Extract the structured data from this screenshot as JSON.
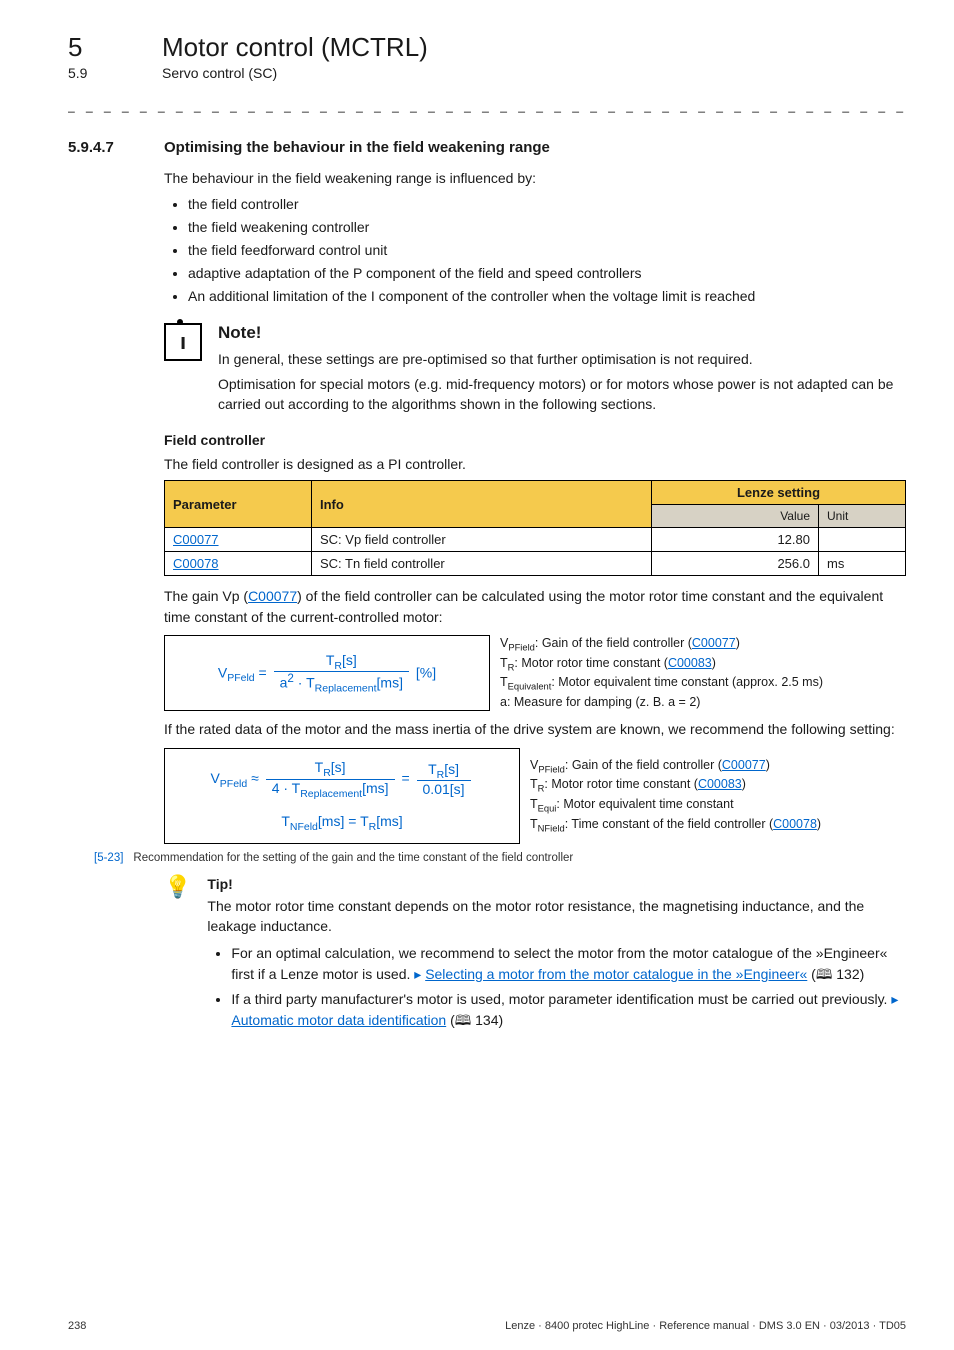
{
  "breadcrumb": {
    "chapter_num": "5",
    "chapter_title": "Motor control (MCTRL)",
    "section_num": "5.9",
    "section_title": "Servo control (SC)"
  },
  "dashes": "_ _ _ _ _ _ _ _ _ _ _ _ _ _ _ _ _ _ _ _ _ _ _ _ _ _ _ _ _ _ _ _ _ _ _ _ _ _ _ _ _ _ _ _ _ _ _ _ _ _ _ _ _ _ _ _ _ _ _ _ _ _ _ _",
  "heading": {
    "num": "5.9.4.7",
    "title": "Optimising the behaviour in the field weakening range"
  },
  "intro": "The behaviour in the field weakening range is influenced by:",
  "bullets": [
    "the field controller",
    "the field weakening controller",
    "the field feedforward control unit",
    "adaptive adaptation of the P component of the field and speed controllers",
    "An additional limitation of the I component of the controller when the voltage limit is reached"
  ],
  "note": {
    "title": "Note!",
    "p1": "In general, these settings are pre-optimised so that further optimisation is not required.",
    "p2": "Optimisation for special motors (e.g. mid-frequency motors) or for motors whose power is not adapted can be carried out according to the algorithms shown in the following sections."
  },
  "field_controller": {
    "heading": "Field controller",
    "text": "The field controller is designed as a PI controller."
  },
  "table": {
    "headers": {
      "param": "Parameter",
      "info": "Info",
      "lenze": "Lenze setting",
      "value": "Value",
      "unit": "Unit"
    },
    "rows": [
      {
        "param": "C00077",
        "info": "SC: Vp field controller",
        "value": "12.80",
        "unit": ""
      },
      {
        "param": "C00078",
        "info": "SC: Tn field controller",
        "value": "256.0",
        "unit": "ms"
      }
    ]
  },
  "gain_text_a": "The gain Vp (",
  "gain_link": "C00077",
  "gain_text_b": ") of the field controller can be calculated using the motor rotor time constant and the equivalent time constant of the current-controlled motor:",
  "formula1": {
    "lhs": "V",
    "lhs_sub": "PFeld",
    "num": "T",
    "num_sub": "R",
    "num_unit": "[s]",
    "den_a": "a",
    "den_sup": "2",
    "den_mid": " · T",
    "den_sub": "Replacement",
    "den_unit": "[ms]",
    "tail": " [%]"
  },
  "formula1_desc": {
    "l1a": "V",
    "l1sub": "PField",
    "l1b": ": Gain of the field controller (",
    "l1link": "C00077",
    "l1c": ")",
    "l2a": "T",
    "l2sub": "R",
    "l2b": ": Motor rotor time constant (",
    "l2link": "C00083",
    "l2c": ")",
    "l3a": "T",
    "l3sub": "Equivalent",
    "l3b": ": Motor equivalent time constant (approx. 2.5 ms)",
    "l4": "a: Measure for damping (z. B. a = 2)"
  },
  "mid_text": "If the rated data of the motor and the mass inertia of the drive system are known, we recommend the following setting:",
  "formula2": {
    "lhs": "V",
    "lhs_sub": "PFeld",
    "approx": " ≈ ",
    "f1_num": "T",
    "f1_num_sub": "R",
    "f1_num_unit": "[s]",
    "f1_den_a": "4 · T",
    "f1_den_sub": "Replacement",
    "f1_den_unit": "[ms]",
    "eq": " = ",
    "f2_num": "T",
    "f2_num_sub": "R",
    "f2_num_unit": "[s]",
    "f2_den": "0.01[s]",
    "line2_a": "T",
    "line2_a_sub": "NFeld",
    "line2_a_unit": "[ms]",
    "line2_eq": " = ",
    "line2_b": "T",
    "line2_b_sub": "R",
    "line2_b_unit": "[ms]"
  },
  "formula2_desc": {
    "l1a": "V",
    "l1sub": "PField",
    "l1b": ": Gain of the field controller (",
    "l1link": "C00077",
    "l1c": ")",
    "l2a": "T",
    "l2sub": "R",
    "l2b": ": Motor rotor time constant (",
    "l2link": "C00083",
    "l2c": ")",
    "l3a": "T",
    "l3sub": "Equi",
    "l3b": ": Motor equivalent time constant",
    "l4a": "T",
    "l4sub": "NField",
    "l4b": ": Time constant of the field controller (",
    "l4link": "C00078",
    "l4c": ")"
  },
  "caption": {
    "label": "[5-23]",
    "text": "Recommendation for the setting of the gain and the time constant of the field controller"
  },
  "tip": {
    "title": "Tip!",
    "body": "The motor rotor time constant depends on the motor rotor resistance, the magnetising inductance, and the leakage inductance.",
    "b1a": "For an optimal calculation, we recommend to select the motor from the motor catalogue of the »Engineer« first if a Lenze motor is used.  ",
    "b1link": "Selecting a motor from the motor catalogue in the »Engineer«",
    "b1page": " (🕮 132)",
    "b2a": "If a third party manufacturer's motor is used, motor parameter identification must be carried out previously.  ",
    "b2link": "Automatic motor data identification",
    "b2page": " (🕮 134)"
  },
  "footer": {
    "page": "238",
    "ref": "Lenze · 8400 protec HighLine · Reference manual · DMS 3.0 EN · 03/2013 · TD05"
  },
  "chart_data": {
    "type": "table",
    "title": "Lenze setting",
    "columns": [
      "Parameter",
      "Info",
      "Value",
      "Unit"
    ],
    "rows": [
      [
        "C00077",
        "SC: Vp field controller",
        12.8,
        ""
      ],
      [
        "C00078",
        "SC: Tn field controller",
        256.0,
        "ms"
      ]
    ]
  }
}
